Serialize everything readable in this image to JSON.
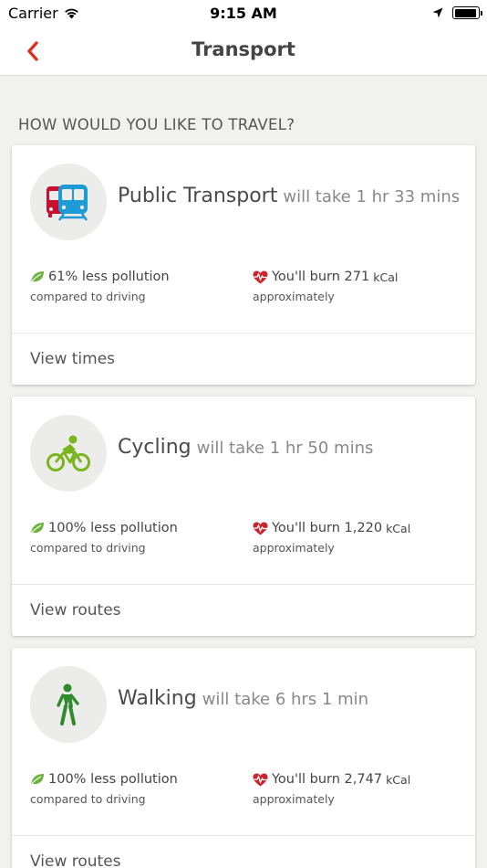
{
  "status_bar": {
    "carrier": "Carrier",
    "time": "9:15 AM",
    "battery_level": 0.95
  },
  "nav": {
    "title": "Transport",
    "back_icon": "chevron-left-icon",
    "accent_color": "#d9321e"
  },
  "section_heading": "HOW WOULD YOU LIKE TO TRAVEL?",
  "colors": {
    "leaf": "#6cb33f",
    "heart": "#c9252d",
    "bus": "#c8102e",
    "train": "#1e9ad6",
    "bike": "#7ab51d",
    "walk": "#2e8b2e"
  },
  "options": [
    {
      "mode": "Public Transport",
      "duration": "will take 1 hr 33 mins",
      "icon": "bus-train-icon",
      "pollution": "61% less pollution",
      "pollution_sub": "compared to driving",
      "burn": "You'll burn 271",
      "burn_unit": "kCal",
      "burn_sub": "approximately",
      "action": "View times"
    },
    {
      "mode": "Cycling",
      "duration": "will take 1 hr 50 mins",
      "icon": "bicycle-icon",
      "pollution": "100% less pollution",
      "pollution_sub": "compared to driving",
      "burn": "You'll burn 1,220",
      "burn_unit": "kCal",
      "burn_sub": "approximately",
      "action": "View routes"
    },
    {
      "mode": "Walking",
      "duration": "will take 6 hrs 1 min",
      "icon": "walking-person-icon",
      "pollution": "100% less pollution",
      "pollution_sub": "compared to driving",
      "burn": "You'll burn 2,747",
      "burn_unit": "kCal",
      "burn_sub": "approximately",
      "action": "View routes"
    }
  ]
}
